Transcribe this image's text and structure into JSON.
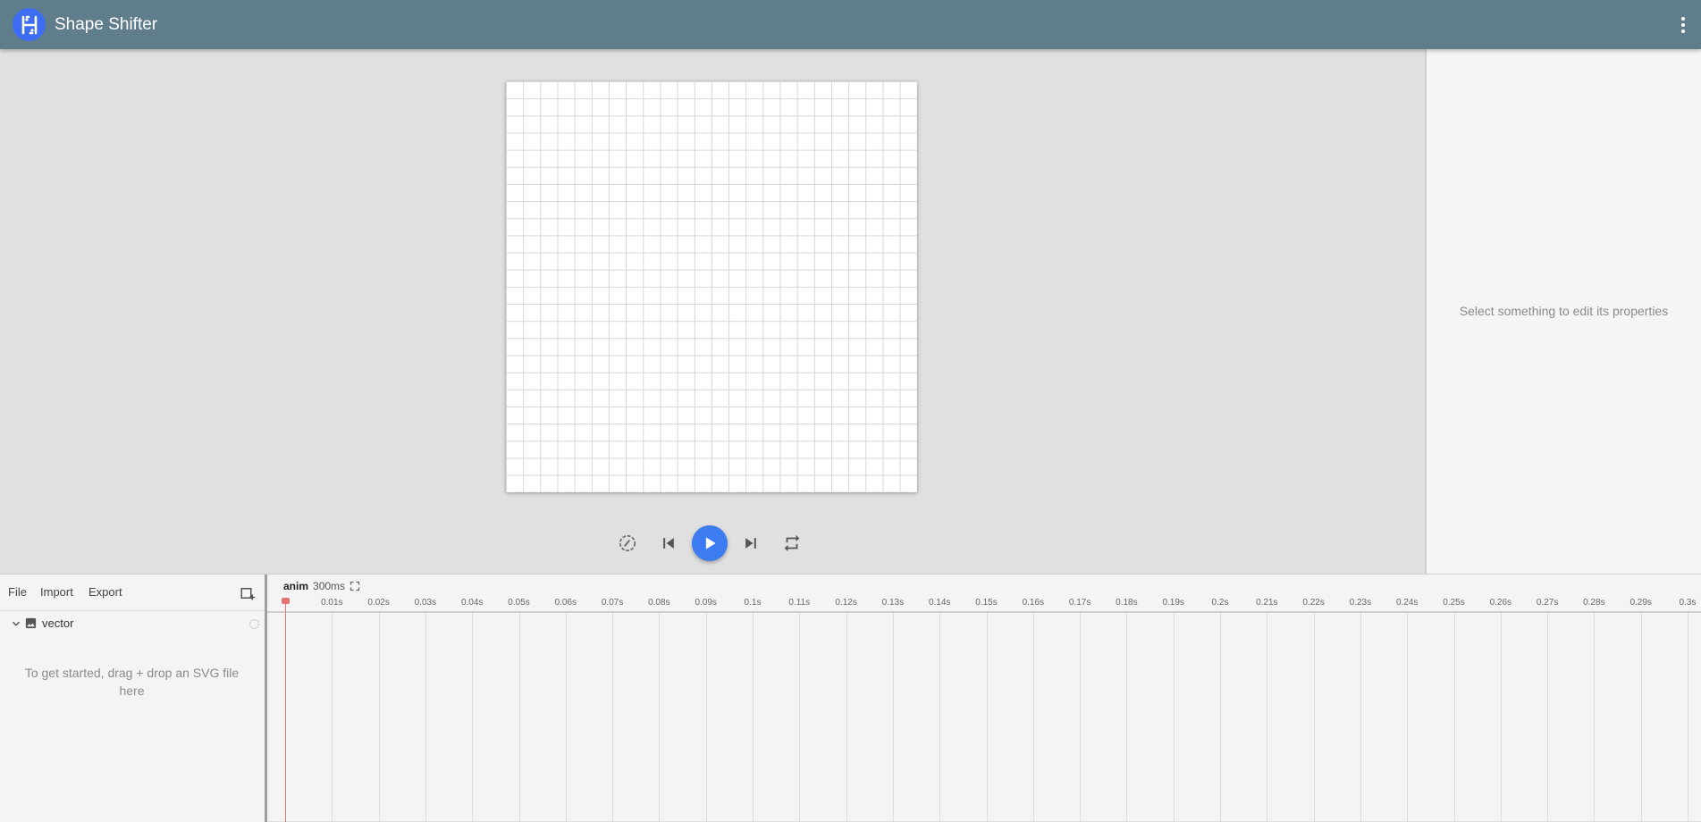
{
  "toolbar": {
    "title": "Shape Shifter",
    "logo_icon": "shape-shifter-logo-icon",
    "menu_icon": "more-vert-icon",
    "color": "#607d8b"
  },
  "player": {
    "controls": [
      "speed-icon",
      "skip-previous-icon",
      "play-icon",
      "skip-next-icon",
      "repeat-icon"
    ],
    "accent": "#3d7cf0"
  },
  "properties": {
    "empty_text": "Select something to edit its properties"
  },
  "layers": {
    "menu": {
      "file": "File",
      "import": "Import",
      "export": "Export"
    },
    "add_icon": "add-layer-icon",
    "root": {
      "label": "vector",
      "expand_icon": "chevron-down-icon",
      "type_icon": "image-icon",
      "visibility_icon": "visibility-circle-icon"
    },
    "empty_message": "To get started, drag + drop an SVG file here"
  },
  "timeline": {
    "animation_name": "anim",
    "duration": "300ms",
    "fullscreen_icon": "fullscreen-icon",
    "ticks": [
      "0.01s",
      "0.02s",
      "0.03s",
      "0.04s",
      "0.05s",
      "0.06s",
      "0.07s",
      "0.08s",
      "0.09s",
      "0.1s",
      "0.11s",
      "0.12s",
      "0.13s",
      "0.14s",
      "0.15s",
      "0.16s",
      "0.17s",
      "0.18s",
      "0.19s",
      "0.2s",
      "0.21s",
      "0.22s",
      "0.23s",
      "0.24s",
      "0.25s",
      "0.26s",
      "0.27s",
      "0.28s",
      "0.29s",
      "0.3s"
    ],
    "current_time": "0s",
    "playhead_color": "#e57373"
  }
}
